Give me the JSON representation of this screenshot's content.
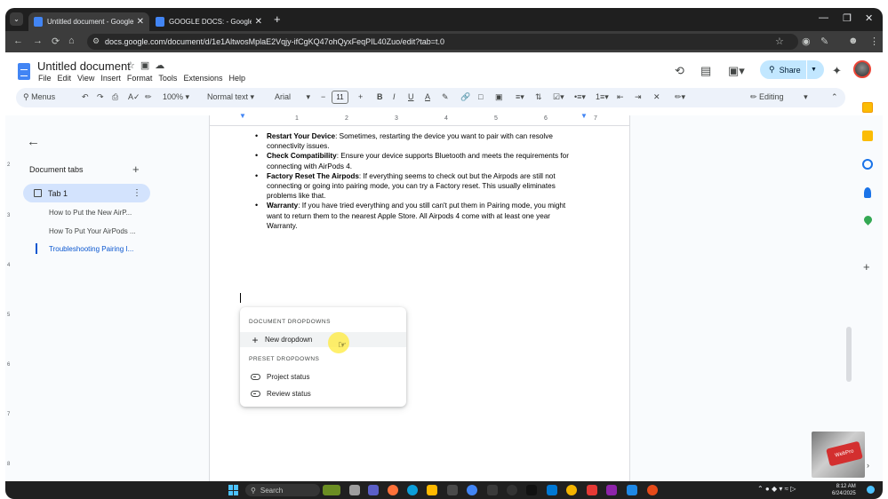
{
  "browser": {
    "tabs": [
      {
        "title": "Untitled document - Google Docs",
        "active": true
      },
      {
        "title": "GOOGLE DOCS: - Google Docs",
        "active": false
      }
    ],
    "url": "docs.google.com/document/d/1e1AltwosMplaE2Vqjy-ifCgKQ47ohQyxFeqPIL40Zuo/edit?tab=t.0"
  },
  "docs": {
    "title": "Untitled document",
    "menu": [
      "File",
      "Edit",
      "View",
      "Insert",
      "Format",
      "Tools",
      "Extensions",
      "Help"
    ],
    "share_label": "Share",
    "toolbar": {
      "menus": "Menus",
      "zoom": "100%",
      "style": "Normal text",
      "font": "Arial",
      "size": "11",
      "mode": "Editing"
    }
  },
  "sidebar": {
    "heading": "Document tabs",
    "tab_label": "Tab 1",
    "outline": [
      "How to Put the New AirP...",
      "How To Put Your AirPods ...",
      "Troubleshooting Pairing I..."
    ]
  },
  "document": {
    "items": [
      {
        "bold": "Restart Your Device",
        "text": ": Sometimes, restarting the device you want to pair with can resolve connectivity issues."
      },
      {
        "bold": "Check Compatibility",
        "text": ": Ensure your device supports Bluetooth and meets the requirements for connecting with AirPods 4."
      },
      {
        "bold": "Factory Reset The Airpods",
        "text": ": If everything seems to check out but the Airpods are still not connecting or going into pairing mode, you can try a Factory reset. This usually eliminates problems like that."
      },
      {
        "bold": "Warranty",
        "text": ": If you have tried everything and you still can't put them in Pairing mode, you might want to return them to the nearest Apple Store. All Airpods 4 come with at least one year Warranty."
      }
    ]
  },
  "popup": {
    "section1": "DOCUMENT DROPDOWNS",
    "new_dropdown": "New dropdown",
    "section2": "PRESET DROPDOWNS",
    "presets": [
      "Project status",
      "Review status"
    ]
  },
  "overlay": {
    "thumbnail_text": "WebPro"
  },
  "taskbar": {
    "search": "Search",
    "time": "8:12 AM",
    "date": "6/24/2025"
  },
  "colors": {
    "accent": "#0b57d0",
    "share_bg": "#c2e7ff",
    "toolbar_bg": "#edf2fa",
    "selected_tab": "#d3e3fd"
  }
}
